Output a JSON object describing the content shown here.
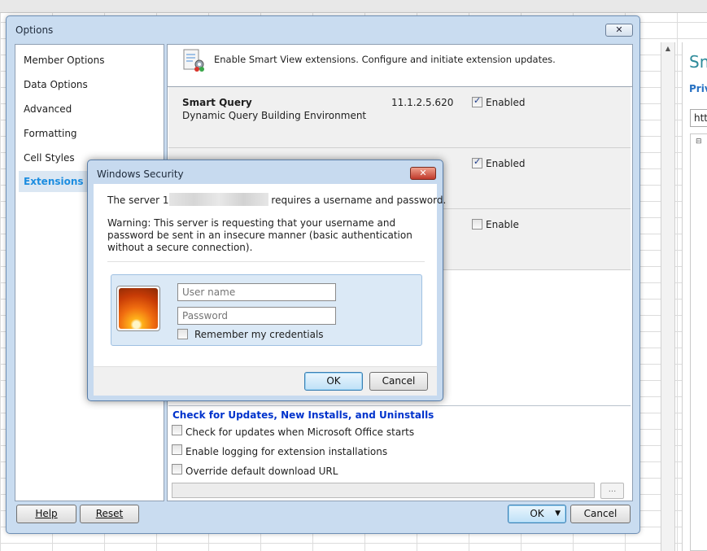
{
  "side_panel": {
    "title": "Sm",
    "subtitle": "Priv",
    "url_value": "http"
  },
  "options_dialog": {
    "title": "Options",
    "close_label": "✕",
    "nav": [
      "Member Options",
      "Data Options",
      "Advanced",
      "Formatting",
      "Cell Styles",
      "Extensions"
    ],
    "active_nav": "Extensions",
    "header_text": "Enable Smart View extensions. Configure and initiate extension updates.",
    "extensions": [
      {
        "name": "Smart Query",
        "description": "Dynamic Query Building Environment",
        "version": "11.1.2.5.620",
        "status": "Enabled",
        "checked": true
      },
      {
        "name": "",
        "description": "",
        "version": "",
        "status": "Enabled",
        "checked": true
      },
      {
        "name": "",
        "description": "",
        "version": "",
        "status": "Enable",
        "checked": false
      }
    ],
    "updates_title": "Check for Updates, New Installs, and Uninstalls",
    "options": [
      "Check for updates when Microsoft Office starts",
      "Enable logging for extension installations",
      "Override default download URL"
    ],
    "browse_label": "...",
    "buttons": {
      "help": "Help",
      "reset": "Reset",
      "ok": "OK",
      "cancel": "Cancel"
    }
  },
  "security_dialog": {
    "title": "Windows Security",
    "close_label": "✕",
    "server_prefix": "The server 1",
    "server_suffix": "requires a username and password.",
    "warning": "Warning: This server is requesting that your username and password be sent in an insecure manner (basic authentication without a secure connection).",
    "username_placeholder": "User name",
    "password_placeholder": "Password",
    "remember_label": "Remember my credentials",
    "ok": "OK",
    "cancel": "Cancel"
  }
}
